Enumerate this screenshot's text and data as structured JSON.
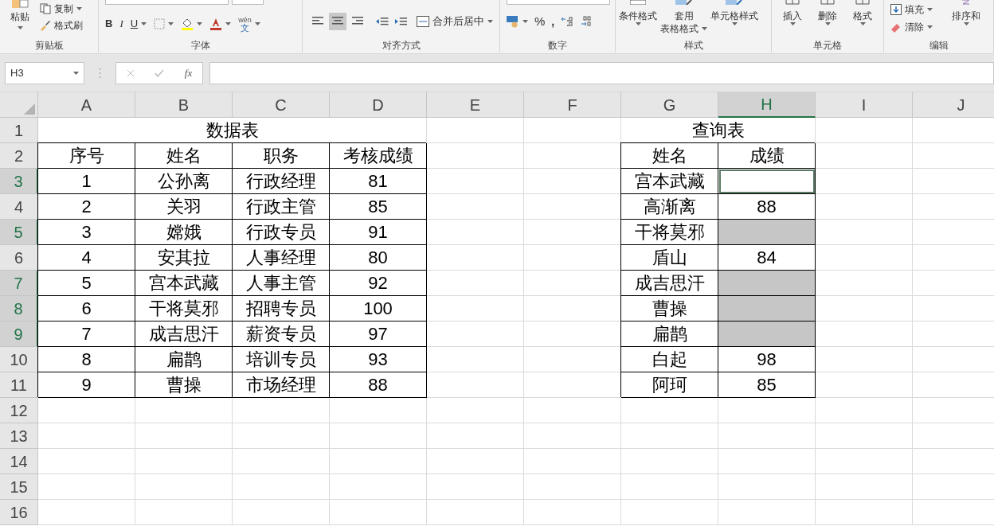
{
  "ribbon": {
    "clipboard": {
      "paste": "粘贴",
      "copy": "复制",
      "format_painter": "格式刷",
      "label": "剪贴板"
    },
    "font": {
      "bold": "B",
      "italic": "I",
      "underline": "U",
      "phonetic_top": "wén",
      "phonetic_bottom": "文",
      "label": "字体"
    },
    "alignment": {
      "align": [
        {
          "selected": false
        },
        {
          "selected": true
        },
        {
          "selected": false
        }
      ],
      "merge": "合并后居中",
      "label": "对齐方式"
    },
    "number": {
      "percent": "%",
      "comma": ",",
      "label": "数字"
    },
    "styles": {
      "conditional": "条件格式",
      "table_top": "套用",
      "table_bottom": "表格格式",
      "cell_styles": "单元格样式",
      "label": "样式"
    },
    "cells": {
      "insert": "插入",
      "delete": "删除",
      "format": "格式",
      "label": "单元格"
    },
    "editing": {
      "fill": "填充",
      "clear": "清除",
      "sort": "排序和",
      "label": "编辑"
    }
  },
  "formula_bar": {
    "name_box": "H3",
    "fx": "fx"
  },
  "columns": [
    {
      "label": "A",
      "selected": false
    },
    {
      "label": "B",
      "selected": false
    },
    {
      "label": "C",
      "selected": false
    },
    {
      "label": "D",
      "selected": false
    },
    {
      "label": "E",
      "selected": false
    },
    {
      "label": "F",
      "selected": false
    },
    {
      "label": "G",
      "selected": false
    },
    {
      "label": "H",
      "selected": true
    },
    {
      "label": "I",
      "selected": false
    },
    {
      "label": "J",
      "selected": false
    }
  ],
  "rows": [
    {
      "header": "1",
      "selected": false,
      "cells": [
        {
          "text": "数据表",
          "kind": "title",
          "bordered": false
        },
        null,
        null,
        null,
        null,
        null,
        {
          "text": "查询表",
          "kind": "title",
          "bordered": false
        },
        null,
        null,
        null
      ]
    },
    {
      "header": "2",
      "selected": false,
      "cells": [
        {
          "text": "序号",
          "bordered": true
        },
        {
          "text": "姓名",
          "bordered": true
        },
        {
          "text": "职务",
          "bordered": true
        },
        {
          "text": "考核成绩",
          "bordered": true
        },
        null,
        null,
        {
          "text": "姓名",
          "bordered": true
        },
        {
          "text": "成绩",
          "bordered": true
        },
        null,
        null
      ]
    },
    {
      "header": "3",
      "selected": true,
      "cells": [
        {
          "text": "1",
          "bordered": true
        },
        {
          "text": "公孙离",
          "bordered": true
        },
        {
          "text": "行政经理",
          "bordered": true
        },
        {
          "text": "81",
          "bordered": true
        },
        null,
        null,
        {
          "text": "宫本武藏",
          "bordered": true
        },
        {
          "bordered": true,
          "selected": true,
          "active": true
        },
        null,
        null
      ]
    },
    {
      "header": "4",
      "selected": false,
      "cells": [
        {
          "text": "2",
          "bordered": true
        },
        {
          "text": "关羽",
          "bordered": true
        },
        {
          "text": "行政主管",
          "bordered": true
        },
        {
          "text": "85",
          "bordered": true
        },
        null,
        null,
        {
          "text": "高渐离",
          "bordered": true
        },
        {
          "text": "88",
          "bordered": true
        },
        null,
        null
      ]
    },
    {
      "header": "5",
      "selected": true,
      "cells": [
        {
          "text": "3",
          "bordered": true
        },
        {
          "text": "嫦娥",
          "bordered": true
        },
        {
          "text": "行政专员",
          "bordered": true
        },
        {
          "text": "91",
          "bordered": true
        },
        null,
        null,
        {
          "text": "干将莫邪",
          "bordered": true
        },
        {
          "bordered": true,
          "selected": true,
          "active": false
        },
        null,
        null
      ]
    },
    {
      "header": "6",
      "selected": false,
      "cells": [
        {
          "text": "4",
          "bordered": true
        },
        {
          "text": "安其拉",
          "bordered": true
        },
        {
          "text": "人事经理",
          "bordered": true
        },
        {
          "text": "80",
          "bordered": true
        },
        null,
        null,
        {
          "text": "盾山",
          "bordered": true
        },
        {
          "text": "84",
          "bordered": true
        },
        null,
        null
      ]
    },
    {
      "header": "7",
      "selected": true,
      "cells": [
        {
          "text": "5",
          "bordered": true
        },
        {
          "text": "宫本武藏",
          "bordered": true
        },
        {
          "text": "人事主管",
          "bordered": true
        },
        {
          "text": "92",
          "bordered": true
        },
        null,
        null,
        {
          "text": "成吉思汗",
          "bordered": true
        },
        {
          "bordered": true,
          "selected": true,
          "active": false
        },
        null,
        null
      ]
    },
    {
      "header": "8",
      "selected": true,
      "cells": [
        {
          "text": "6",
          "bordered": true
        },
        {
          "text": "干将莫邪",
          "bordered": true
        },
        {
          "text": "招聘专员",
          "bordered": true
        },
        {
          "text": "100",
          "bordered": true
        },
        null,
        null,
        {
          "text": "曹操",
          "bordered": true
        },
        {
          "bordered": true,
          "selected": true,
          "active": false
        },
        null,
        null
      ]
    },
    {
      "header": "9",
      "selected": true,
      "cells": [
        {
          "text": "7",
          "bordered": true
        },
        {
          "text": "成吉思汗",
          "bordered": true
        },
        {
          "text": "薪资专员",
          "bordered": true
        },
        {
          "text": "97",
          "bordered": true
        },
        null,
        null,
        {
          "text": "扁鹊",
          "bordered": true
        },
        {
          "bordered": true,
          "selected": true,
          "active": false
        },
        null,
        null
      ]
    },
    {
      "header": "10",
      "selected": false,
      "cells": [
        {
          "text": "8",
          "bordered": true
        },
        {
          "text": "扁鹊",
          "bordered": true
        },
        {
          "text": "培训专员",
          "bordered": true
        },
        {
          "text": "93",
          "bordered": true
        },
        null,
        null,
        {
          "text": "白起",
          "bordered": true
        },
        {
          "text": "98",
          "bordered": true
        },
        null,
        null
      ]
    },
    {
      "header": "11",
      "selected": false,
      "cells": [
        {
          "text": "9",
          "bordered": true
        },
        {
          "text": "曹操",
          "bordered": true
        },
        {
          "text": "市场经理",
          "bordered": true
        },
        {
          "text": "88",
          "bordered": true
        },
        null,
        null,
        {
          "text": "阿珂",
          "bordered": true
        },
        {
          "text": "85",
          "bordered": true
        },
        null,
        null
      ]
    },
    {
      "header": "12",
      "selected": false,
      "cells": [
        null,
        null,
        null,
        null,
        null,
        null,
        null,
        null,
        null,
        null
      ]
    },
    {
      "header": "13",
      "selected": false,
      "cells": [
        null,
        null,
        null,
        null,
        null,
        null,
        null,
        null,
        null,
        null
      ]
    },
    {
      "header": "14",
      "selected": false,
      "cells": [
        null,
        null,
        null,
        null,
        null,
        null,
        null,
        null,
        null,
        null
      ]
    },
    {
      "header": "15",
      "selected": false,
      "cells": [
        null,
        null,
        null,
        null,
        null,
        null,
        null,
        null,
        null,
        null
      ]
    },
    {
      "header": "16",
      "selected": false,
      "cells": [
        null,
        null,
        null,
        null,
        null,
        null,
        null,
        null,
        null,
        null
      ]
    }
  ]
}
